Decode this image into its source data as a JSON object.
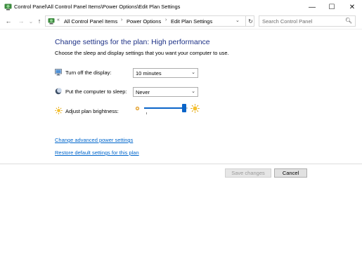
{
  "window": {
    "title": "Control Panel\\All Control Panel Items\\Power Options\\Edit Plan Settings",
    "minimize": "—",
    "maximize": "☐",
    "close": "✕"
  },
  "nav": {
    "back": "←",
    "forward": "→",
    "recent": "⌄",
    "up": "↑",
    "overflow": "«",
    "breadcrumbs": [
      "All Control Panel Items",
      "Power Options",
      "Edit Plan Settings"
    ],
    "separator": "›",
    "dropdown": "⌄",
    "refresh": "↻",
    "search_placeholder": "Search Control Panel",
    "search_icon": "search-icon"
  },
  "main": {
    "title": "Change settings for the plan: High performance",
    "description": "Choose the sleep and display settings that you want your computer to use.",
    "settings": [
      {
        "label": "Turn off the display:",
        "value": "10 minutes",
        "icon": "monitor-icon"
      },
      {
        "label": "Put the computer to sleep:",
        "value": "Never",
        "icon": "moon-icon"
      }
    ],
    "brightness": {
      "label": "Adjust plan brightness:",
      "level": 0.92
    },
    "links": {
      "advanced": "Change advanced power settings",
      "restore": "Restore default settings for this plan"
    }
  },
  "footer": {
    "save_label": "Save changes",
    "cancel_label": "Cancel"
  },
  "colors": {
    "title": "#1e3287",
    "link": "#0066cc",
    "accent": "#0a64c8"
  }
}
